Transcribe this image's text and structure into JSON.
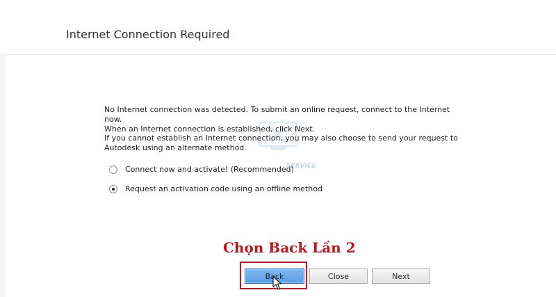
{
  "dialog": {
    "title": "Internet Connection Required",
    "paragraph1_line1": "No Internet connection was detected. To submit an online request, connect to the Internet now.",
    "paragraph1_line2": "When an Internet connection is established, click Next.",
    "paragraph2_line1": "If you cannot establish an Internet connection, you may also choose to send your request to",
    "paragraph2_line2": "Autodesk using an alternate method.",
    "options": [
      {
        "label": "Connect now and activate! (Recommended)",
        "selected": false
      },
      {
        "label": "Request an activation code using an offline method",
        "selected": true
      }
    ],
    "buttons": {
      "back": "Back",
      "close": "Close",
      "next": "Next"
    }
  },
  "annotation": {
    "text": "Chọn Back Lần 2",
    "color": "#c0161c"
  },
  "watermark": {
    "text": "SERVICE"
  },
  "icons": {
    "cursor": "arrow-cursor-icon",
    "watermark": "tools-logo-icon"
  }
}
